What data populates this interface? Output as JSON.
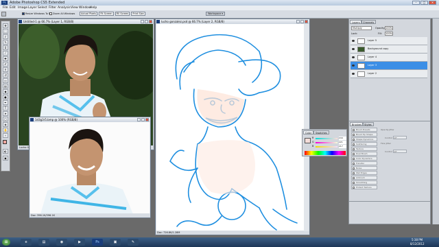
{
  "app": {
    "title": "Adobe Photoshop CS5 Extended",
    "icon": "Ps",
    "window_controls": [
      "–",
      "□",
      "✕"
    ]
  },
  "menubar": [
    "File",
    "Edit",
    "Image",
    "Layer",
    "Select",
    "Filter",
    "Analysis",
    "View",
    "Window",
    "Help"
  ],
  "options_bar": {
    "checkbox_1": "Resize Windows To Fit",
    "checkbox_2": "Zoom All Windows",
    "btn_actual": "Actual Pixels",
    "btn_fit": "Fit Screen",
    "btn_fill": "Fill Screen",
    "btn_print": "Print Size",
    "workspace": "Workspace ▾"
  },
  "windows": {
    "untitled": {
      "title": "Untitled-1 @ 66.7% (Layer 1, RGB/8)",
      "status": "Lucho Go...",
      "status2": ""
    },
    "doc2": {
      "title": "1d3g3r5.bmp @ 100% (RGB/8)",
      "status": "Doc: 396.1K/396.1K"
    },
    "sketch": {
      "title": "lucho gonzalez.psd @ 66.7% (Layer 2, RGB/8)",
      "status": "Doc: 726.8K/1.28M"
    }
  },
  "layers_panel": {
    "tabs": [
      "Layers",
      "Channels"
    ],
    "blend": "Multiply",
    "opacity_label": "Opacity:",
    "opacity": "100%",
    "fill_label": "Fill:",
    "fill": "100%",
    "lock_label": "Lock:",
    "layers": [
      {
        "name": "Layer 5"
      },
      {
        "name": "Background copy"
      },
      {
        "name": "Layer 4"
      },
      {
        "name": "Layer 3"
      },
      {
        "name": "Layer 2"
      }
    ]
  },
  "color_panel": {
    "tabs": [
      "Color",
      "Swatches"
    ],
    "r": "R",
    "g": "G",
    "b": "B",
    "r_val": "244",
    "g_val": "221",
    "b_val": "217"
  },
  "styles_panel": {
    "tabs": [
      "Brushes",
      "Styles"
    ],
    "items": [
      "Brush Presets",
      "Brush Tip Shape",
      "Shape Dynamics",
      "Scattering",
      "Texture",
      "Dual Brush",
      "Color Dynamics",
      "Transfer",
      "Noise",
      "Wet Edges",
      "Airbrush",
      "Smoothing",
      "Protect Texture"
    ],
    "right_labels": [
      "Opacity Jitter",
      "Control",
      "Flow Jitter",
      "Control"
    ],
    "off": "Off"
  },
  "taskbar": {
    "start": "⊞",
    "clock_time": "5:38 PM",
    "clock_date": "8/12/2012"
  },
  "colors": {
    "accent": "#3399ff",
    "selected_layer": "#3b8ee6",
    "sketch_blue": "#1f8fe0"
  }
}
